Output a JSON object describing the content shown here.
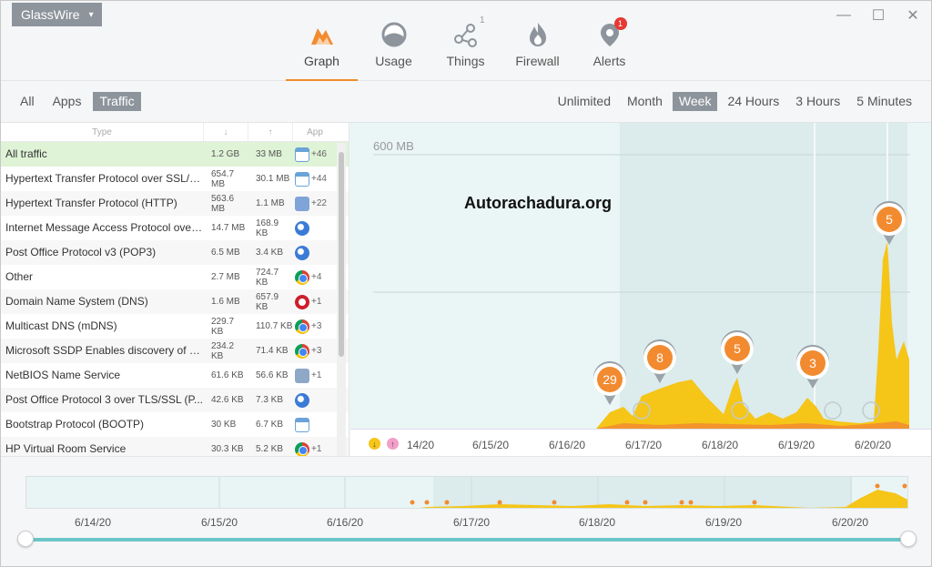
{
  "app": {
    "name": "GlassWire"
  },
  "nav": [
    {
      "key": "graph",
      "label": "Graph",
      "active": true
    },
    {
      "key": "usage",
      "label": "Usage",
      "active": false
    },
    {
      "key": "things",
      "label": "Things",
      "active": false,
      "count": "1"
    },
    {
      "key": "firewall",
      "label": "Firewall",
      "active": false
    },
    {
      "key": "alerts",
      "label": "Alerts",
      "active": false,
      "badge": "1"
    }
  ],
  "filters": {
    "tabs": [
      "All",
      "Apps",
      "Traffic"
    ],
    "active_tab": "Traffic",
    "ranges": [
      "Unlimited",
      "Month",
      "Week",
      "24 Hours",
      "3 Hours",
      "5 Minutes"
    ],
    "active_range": "Week"
  },
  "table": {
    "headers": {
      "type": "Type",
      "down": "↓",
      "up": "↑",
      "app": "App"
    },
    "rows": [
      {
        "type": "All traffic",
        "down": "1.2 GB",
        "up": "33 MB",
        "app_icon": "window-icon",
        "extra": "+46"
      },
      {
        "type": "Hypertext Transfer Protocol over SSL/T...",
        "down": "654.7 MB",
        "up": "30.1 MB",
        "app_icon": "window-icon",
        "extra": "+44"
      },
      {
        "type": "Hypertext Transfer Protocol (HTTP)",
        "down": "563.6 MB",
        "up": "1.1 MB",
        "app_icon": "multi-app-icon",
        "extra": "+22"
      },
      {
        "type": "Internet Message Access Protocol over ...",
        "down": "14.7 MB",
        "up": "168.9 KB",
        "app_icon": "thunderbird-icon",
        "extra": ""
      },
      {
        "type": "Post Office Protocol v3 (POP3)",
        "down": "6.5 MB",
        "up": "3.4 KB",
        "app_icon": "thunderbird-icon",
        "extra": ""
      },
      {
        "type": "Other",
        "down": "2.7 MB",
        "up": "724.7 KB",
        "app_icon": "chrome-icon",
        "extra": "+4"
      },
      {
        "type": "Domain Name System (DNS)",
        "down": "1.6 MB",
        "up": "657.9 KB",
        "app_icon": "opera-icon",
        "extra": "+1"
      },
      {
        "type": "Multicast DNS (mDNS)",
        "down": "229.7 KB",
        "up": "110.7 KB",
        "app_icon": "chrome-icon",
        "extra": "+3"
      },
      {
        "type": "Microsoft SSDP Enables discovery of U...",
        "down": "234.2 KB",
        "up": "71.4 KB",
        "app_icon": "chrome-icon",
        "extra": "+3"
      },
      {
        "type": "NetBIOS Name Service",
        "down": "61.6 KB",
        "up": "56.6 KB",
        "app_icon": "network-icon",
        "extra": "+1"
      },
      {
        "type": "Post Office Protocol 3 over TLS/SSL (P...",
        "down": "42.6 KB",
        "up": "7.3 KB",
        "app_icon": "thunderbird-icon",
        "extra": ""
      },
      {
        "type": "Bootstrap Protocol (BOOTP)",
        "down": "30 KB",
        "up": "6.7 KB",
        "app_icon": "window-icon",
        "extra": ""
      },
      {
        "type": "HP Virtual Room Service",
        "down": "30.3 KB",
        "up": "5.2 KB",
        "app_icon": "chrome-icon",
        "extra": "+1"
      }
    ]
  },
  "graph": {
    "watermark": "Autorachadura.org",
    "scale_label": "600 MB",
    "x_labels": [
      "14/20",
      "6/15/20",
      "6/16/20",
      "6/17/20",
      "6/18/20",
      "6/19/20",
      "6/20/20"
    ],
    "markers": [
      "29",
      "8",
      "5",
      "3",
      "5"
    ],
    "colors": {
      "download": "#f5c518",
      "upload": "#f28b30",
      "marker": "#f28b30"
    }
  },
  "overview": {
    "x_labels": [
      "6/14/20",
      "6/15/20",
      "6/16/20",
      "6/17/20",
      "6/18/20",
      "6/19/20",
      "6/20/20"
    ]
  }
}
